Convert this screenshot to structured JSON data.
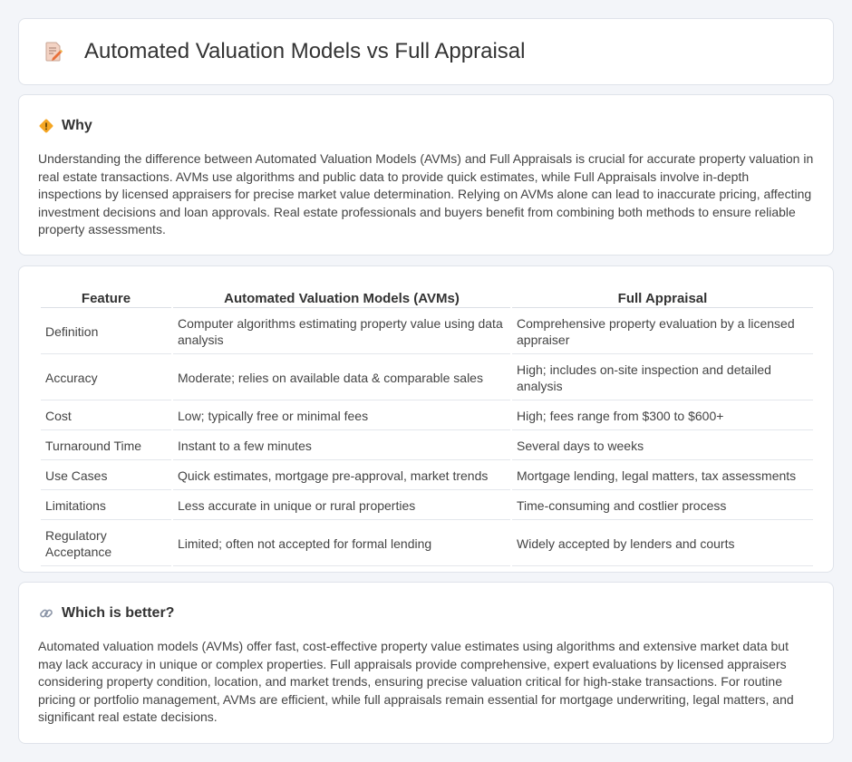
{
  "header": {
    "title": "Automated Valuation Models vs Full Appraisal",
    "icon": "document-edit-icon"
  },
  "why": {
    "title": "Why",
    "icon": "diamond-sign-icon",
    "text": "Understanding the difference between Automated Valuation Models (AVMs) and Full Appraisals is crucial for accurate property valuation in real estate transactions. AVMs use algorithms and public data to provide quick estimates, while Full Appraisals involve in-depth inspections by licensed appraisers for precise market value determination. Relying on AVMs alone can lead to inaccurate pricing, affecting investment decisions and loan approvals. Real estate professionals and buyers benefit from combining both methods to ensure reliable property assessments."
  },
  "table": {
    "headers": [
      "Feature",
      "Automated Valuation Models (AVMs)",
      "Full Appraisal"
    ],
    "rows": [
      [
        "Definition",
        "Computer algorithms estimating property value using data analysis",
        "Comprehensive property evaluation by a licensed appraiser"
      ],
      [
        "Accuracy",
        "Moderate; relies on available data & comparable sales",
        "High; includes on-site inspection and detailed analysis"
      ],
      [
        "Cost",
        "Low; typically free or minimal fees",
        "High; fees range from $300 to $600+"
      ],
      [
        "Turnaround Time",
        "Instant to a few minutes",
        "Several days to weeks"
      ],
      [
        "Use Cases",
        "Quick estimates, mortgage pre-approval, market trends",
        "Mortgage lending, legal matters, tax assessments"
      ],
      [
        "Limitations",
        "Less accurate in unique or rural properties",
        "Time-consuming and costlier process"
      ],
      [
        "Regulatory Acceptance",
        "Limited; often not accepted for formal lending",
        "Widely accepted by lenders and courts"
      ]
    ]
  },
  "better": {
    "title": "Which is better?",
    "icon": "link-icon",
    "text": "Automated valuation models (AVMs) offer fast, cost-effective property value estimates using algorithms and extensive market data but may lack accuracy in unique or complex properties. Full appraisals provide comprehensive, expert evaluations by licensed appraisers considering property condition, location, and market trends, ensuring precise valuation critical for high-stake transactions. For routine pricing or portfolio management, AVMs are efficient, while full appraisals remain essential for mortgage underwriting, legal matters, and significant real estate decisions."
  }
}
